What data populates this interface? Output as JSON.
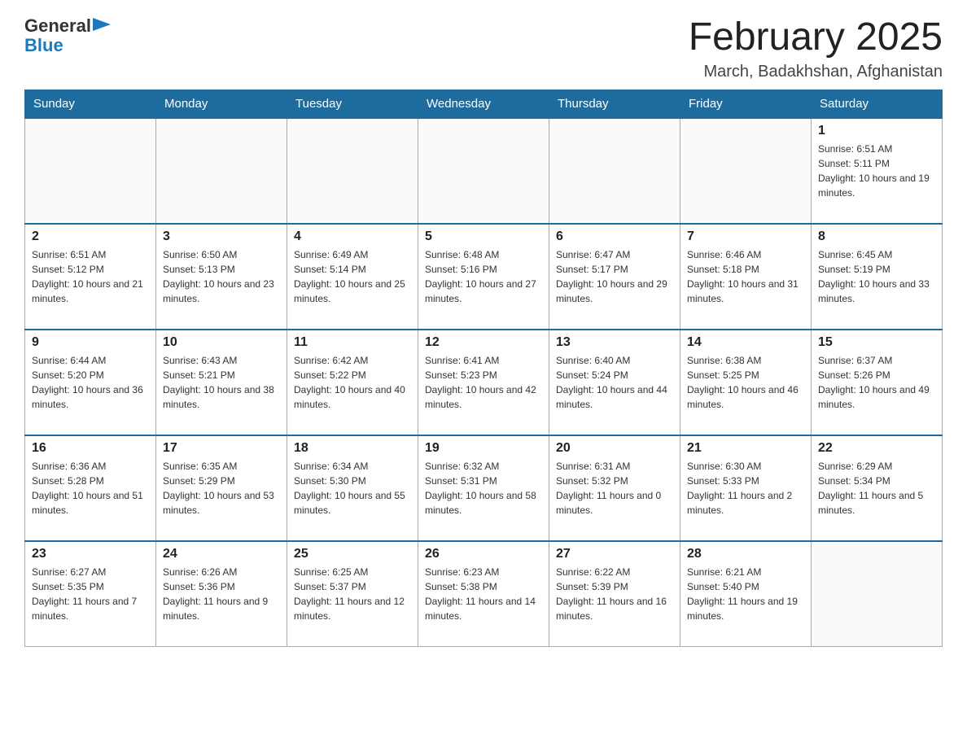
{
  "header": {
    "logo": {
      "general": "General",
      "blue": "Blue",
      "arrow": "▶"
    },
    "title": "February 2025",
    "subtitle": "March, Badakhshan, Afghanistan"
  },
  "calendar": {
    "days_of_week": [
      "Sunday",
      "Monday",
      "Tuesday",
      "Wednesday",
      "Thursday",
      "Friday",
      "Saturday"
    ],
    "weeks": [
      [
        {
          "day": "",
          "info": ""
        },
        {
          "day": "",
          "info": ""
        },
        {
          "day": "",
          "info": ""
        },
        {
          "day": "",
          "info": ""
        },
        {
          "day": "",
          "info": ""
        },
        {
          "day": "",
          "info": ""
        },
        {
          "day": "1",
          "info": "Sunrise: 6:51 AM\nSunset: 5:11 PM\nDaylight: 10 hours and 19 minutes."
        }
      ],
      [
        {
          "day": "2",
          "info": "Sunrise: 6:51 AM\nSunset: 5:12 PM\nDaylight: 10 hours and 21 minutes."
        },
        {
          "day": "3",
          "info": "Sunrise: 6:50 AM\nSunset: 5:13 PM\nDaylight: 10 hours and 23 minutes."
        },
        {
          "day": "4",
          "info": "Sunrise: 6:49 AM\nSunset: 5:14 PM\nDaylight: 10 hours and 25 minutes."
        },
        {
          "day": "5",
          "info": "Sunrise: 6:48 AM\nSunset: 5:16 PM\nDaylight: 10 hours and 27 minutes."
        },
        {
          "day": "6",
          "info": "Sunrise: 6:47 AM\nSunset: 5:17 PM\nDaylight: 10 hours and 29 minutes."
        },
        {
          "day": "7",
          "info": "Sunrise: 6:46 AM\nSunset: 5:18 PM\nDaylight: 10 hours and 31 minutes."
        },
        {
          "day": "8",
          "info": "Sunrise: 6:45 AM\nSunset: 5:19 PM\nDaylight: 10 hours and 33 minutes."
        }
      ],
      [
        {
          "day": "9",
          "info": "Sunrise: 6:44 AM\nSunset: 5:20 PM\nDaylight: 10 hours and 36 minutes."
        },
        {
          "day": "10",
          "info": "Sunrise: 6:43 AM\nSunset: 5:21 PM\nDaylight: 10 hours and 38 minutes."
        },
        {
          "day": "11",
          "info": "Sunrise: 6:42 AM\nSunset: 5:22 PM\nDaylight: 10 hours and 40 minutes."
        },
        {
          "day": "12",
          "info": "Sunrise: 6:41 AM\nSunset: 5:23 PM\nDaylight: 10 hours and 42 minutes."
        },
        {
          "day": "13",
          "info": "Sunrise: 6:40 AM\nSunset: 5:24 PM\nDaylight: 10 hours and 44 minutes."
        },
        {
          "day": "14",
          "info": "Sunrise: 6:38 AM\nSunset: 5:25 PM\nDaylight: 10 hours and 46 minutes."
        },
        {
          "day": "15",
          "info": "Sunrise: 6:37 AM\nSunset: 5:26 PM\nDaylight: 10 hours and 49 minutes."
        }
      ],
      [
        {
          "day": "16",
          "info": "Sunrise: 6:36 AM\nSunset: 5:28 PM\nDaylight: 10 hours and 51 minutes."
        },
        {
          "day": "17",
          "info": "Sunrise: 6:35 AM\nSunset: 5:29 PM\nDaylight: 10 hours and 53 minutes."
        },
        {
          "day": "18",
          "info": "Sunrise: 6:34 AM\nSunset: 5:30 PM\nDaylight: 10 hours and 55 minutes."
        },
        {
          "day": "19",
          "info": "Sunrise: 6:32 AM\nSunset: 5:31 PM\nDaylight: 10 hours and 58 minutes."
        },
        {
          "day": "20",
          "info": "Sunrise: 6:31 AM\nSunset: 5:32 PM\nDaylight: 11 hours and 0 minutes."
        },
        {
          "day": "21",
          "info": "Sunrise: 6:30 AM\nSunset: 5:33 PM\nDaylight: 11 hours and 2 minutes."
        },
        {
          "day": "22",
          "info": "Sunrise: 6:29 AM\nSunset: 5:34 PM\nDaylight: 11 hours and 5 minutes."
        }
      ],
      [
        {
          "day": "23",
          "info": "Sunrise: 6:27 AM\nSunset: 5:35 PM\nDaylight: 11 hours and 7 minutes."
        },
        {
          "day": "24",
          "info": "Sunrise: 6:26 AM\nSunset: 5:36 PM\nDaylight: 11 hours and 9 minutes."
        },
        {
          "day": "25",
          "info": "Sunrise: 6:25 AM\nSunset: 5:37 PM\nDaylight: 11 hours and 12 minutes."
        },
        {
          "day": "26",
          "info": "Sunrise: 6:23 AM\nSunset: 5:38 PM\nDaylight: 11 hours and 14 minutes."
        },
        {
          "day": "27",
          "info": "Sunrise: 6:22 AM\nSunset: 5:39 PM\nDaylight: 11 hours and 16 minutes."
        },
        {
          "day": "28",
          "info": "Sunrise: 6:21 AM\nSunset: 5:40 PM\nDaylight: 11 hours and 19 minutes."
        },
        {
          "day": "",
          "info": ""
        }
      ]
    ]
  }
}
